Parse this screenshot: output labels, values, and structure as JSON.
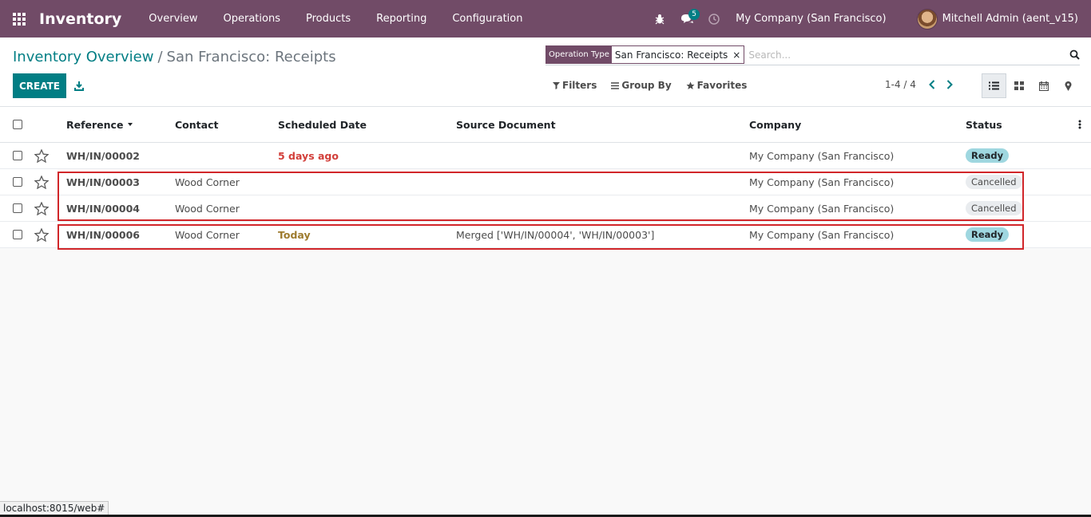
{
  "navbar": {
    "app_name": "Inventory",
    "menu": [
      "Overview",
      "Operations",
      "Products",
      "Reporting",
      "Configuration"
    ],
    "messages_count": "5",
    "company": "My Company (San Francisco)",
    "user": "Mitchell Admin (aent_v15)"
  },
  "breadcrumb": {
    "parent": "Inventory Overview",
    "separator": "/",
    "current": "San Francisco: Receipts"
  },
  "search": {
    "facet_label": "Operation Type",
    "facet_value": "San Francisco: Receipts",
    "facet_remove": "×",
    "placeholder": "Search..."
  },
  "actions": {
    "create_label": "CREATE"
  },
  "filters": {
    "filters_label": "Filters",
    "group_by_label": "Group By",
    "favorites_label": "Favorites"
  },
  "pager": {
    "value": "1-4 / 4"
  },
  "table": {
    "headers": {
      "reference": "Reference",
      "contact": "Contact",
      "scheduled_date": "Scheduled Date",
      "source_document": "Source Document",
      "company": "Company",
      "status": "Status"
    },
    "rows": [
      {
        "reference": "WH/IN/00002",
        "contact": "",
        "scheduled_date": "5 days ago",
        "source_document": "",
        "company": "My Company (San Francisco)",
        "status": "Ready"
      },
      {
        "reference": "WH/IN/00003",
        "contact": "Wood Corner",
        "scheduled_date": "",
        "source_document": "",
        "company": "My Company (San Francisco)",
        "status": "Cancelled"
      },
      {
        "reference": "WH/IN/00004",
        "contact": "Wood Corner",
        "scheduled_date": "",
        "source_document": "",
        "company": "My Company (San Francisco)",
        "status": "Cancelled"
      },
      {
        "reference": "WH/IN/00006",
        "contact": "Wood Corner",
        "scheduled_date": "Today",
        "source_document": "Merged ['WH/IN/00004', 'WH/IN/00003']",
        "company": "My Company (San Francisco)",
        "status": "Ready"
      }
    ]
  },
  "statusbar": {
    "url": "localhost:8015/web#"
  },
  "colors": {
    "navbar": "#714b67",
    "primary": "#017e84",
    "late": "#d23f3a",
    "today": "#9e7b2e",
    "ready": "#9fd7e0",
    "highlight": "#d1262a"
  }
}
